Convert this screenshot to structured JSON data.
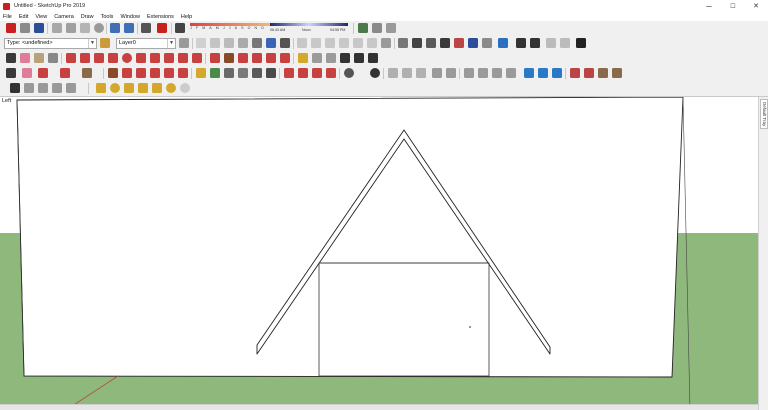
{
  "window": {
    "title": "Untitled - SketchUp Pro 2019",
    "controls": {
      "minimize": "─",
      "maximize": "☐",
      "close": "✕"
    }
  },
  "menu": [
    "File",
    "Edit",
    "View",
    "Camera",
    "Draw",
    "Tools",
    "Window",
    "Extensions",
    "Help"
  ],
  "shadows": {
    "months": [
      "J",
      "F",
      "M",
      "A",
      "M",
      "J",
      "J",
      "A",
      "S",
      "O",
      "N",
      "D"
    ],
    "time_start": "06:43 AM",
    "time_noon": "Noon",
    "time_end": "04:55 PM"
  },
  "style_bar": {
    "type_value": "Type: <undefined>",
    "layer_value": "Layer0"
  },
  "viewport": {
    "scene_label": "Left"
  },
  "tray": {
    "tab_label": "Default Tray"
  },
  "colors": {
    "sky": "#ffffff",
    "ground": "#8eb87c",
    "panel": "#ffffff",
    "accent": "#1565c0",
    "brand": "#c8201f"
  }
}
